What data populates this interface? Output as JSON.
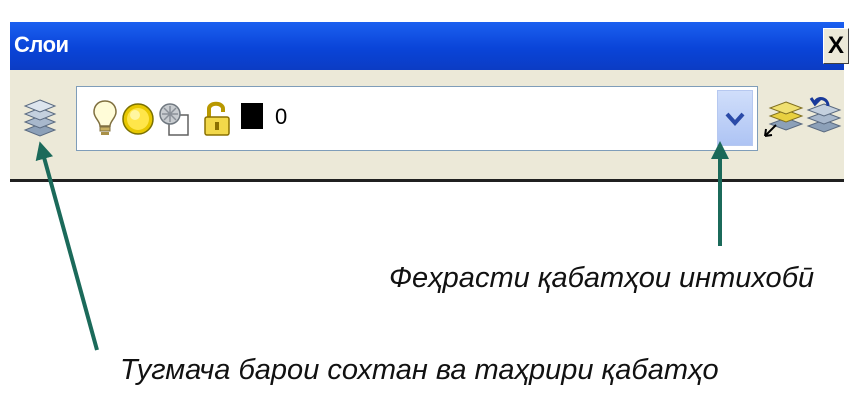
{
  "window": {
    "title": "Слои",
    "close_label": "X"
  },
  "layer_control": {
    "current_layer": "0",
    "state_icons": [
      "light-bulb-on-icon",
      "sun-thaw-icon",
      "viewport-freeze-icon",
      "unlock-icon"
    ],
    "layer_color": "#000000"
  },
  "toolbar_buttons": [
    "layer-properties-manager-icon",
    "make-object-layer-current-icon",
    "layer-previous-icon"
  ],
  "annotations": {
    "layer_list_caption": "Феҳрасти қабатҳои интихобӣ",
    "layer_button_caption": "Тугмача барои сохтан ва таҳрири қабатҳо"
  },
  "colors": {
    "titlebar": "#0A44D8",
    "toolbar_bg": "#ECE9D8",
    "arrow": "#1B6A5A"
  }
}
